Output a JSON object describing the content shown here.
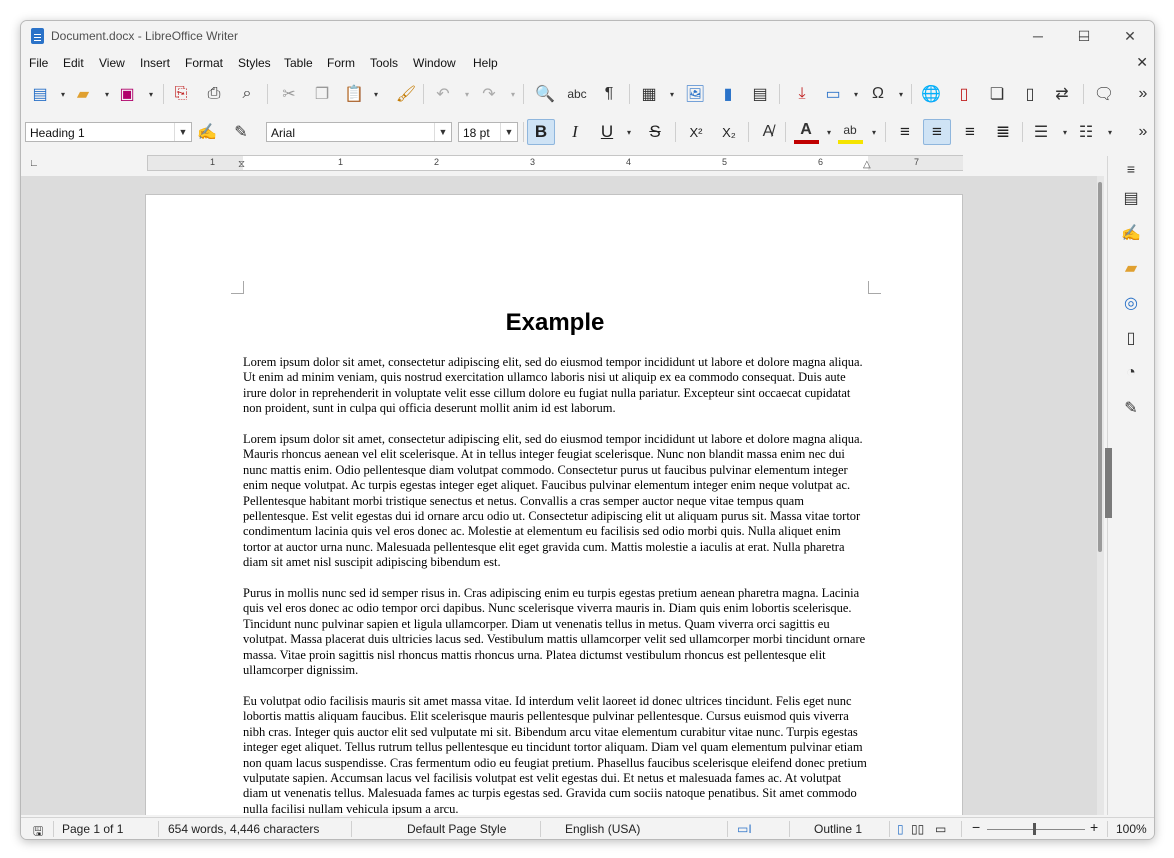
{
  "window": {
    "title": "Document.docx - LibreOffice Writer",
    "controls": {
      "minimize": "─",
      "maximize": "☐",
      "close": "✕"
    }
  },
  "menu": [
    {
      "label": "File"
    },
    {
      "label": "Edit"
    },
    {
      "label": "View"
    },
    {
      "label": "Insert"
    },
    {
      "label": "Format"
    },
    {
      "label": "Styles"
    },
    {
      "label": "Table"
    },
    {
      "label": "Form"
    },
    {
      "label": "Tools"
    },
    {
      "label": "Window"
    },
    {
      "label": "Help"
    }
  ],
  "toolbar": {
    "paragraph_style": "Heading 1",
    "font_name": "Arial",
    "font_size": "18 pt",
    "bold_label": "B",
    "italic_label": "I",
    "underline_label": "U",
    "strike_label": "S",
    "superscript_label": "X²",
    "subscript_label": "X₂",
    "more_label": "»",
    "font_color": "#c00000",
    "highlight_color": "#f5e400",
    "bold_active": true,
    "align_center_active": true
  },
  "ruler": {
    "numbers": [
      "1",
      "1",
      "2",
      "3",
      "4",
      "5",
      "6",
      "7"
    ]
  },
  "document": {
    "heading": "Example",
    "paragraphs": [
      "Lorem ipsum dolor sit amet, consectetur adipiscing elit, sed do eiusmod tempor incididunt ut labore et dolore magna aliqua. Ut enim ad minim veniam, quis nostrud exercitation ullamco laboris nisi ut aliquip ex ea commodo consequat. Duis aute irure dolor in reprehenderit in voluptate velit esse cillum dolore eu fugiat nulla pariatur. Excepteur sint occaecat cupidatat non proident, sunt in culpa qui officia deserunt mollit anim id est laborum.",
      "Lorem ipsum dolor sit amet, consectetur adipiscing elit, sed do eiusmod tempor incididunt ut labore et dolore magna aliqua. Mauris rhoncus aenean vel elit scelerisque. At in tellus integer feugiat scelerisque. Nunc non blandit massa enim nec dui nunc mattis enim. Odio pellentesque diam volutpat commodo. Consectetur purus ut faucibus pulvinar elementum integer enim neque volutpat. Ac turpis egestas integer eget aliquet. Faucibus pulvinar elementum integer enim neque volutpat ac. Pellentesque habitant morbi tristique senectus et netus. Convallis a cras semper auctor neque vitae tempus quam pellentesque. Est velit egestas dui id ornare arcu odio ut. Consectetur adipiscing elit ut aliquam purus sit. Massa vitae tortor condimentum lacinia quis vel eros donec ac. Molestie at elementum eu facilisis sed odio morbi quis. Nulla aliquet enim tortor at auctor urna nunc. Malesuada pellentesque elit eget gravida cum. Mattis molestie a iaculis at erat. Nulla pharetra diam sit amet nisl suscipit adipiscing bibendum est.",
      "Purus in mollis nunc sed id semper risus in. Cras adipiscing enim eu turpis egestas pretium aenean pharetra magna. Lacinia quis vel eros donec ac odio tempor orci dapibus. Nunc scelerisque viverra mauris in. Diam quis enim lobortis scelerisque. Tincidunt nunc pulvinar sapien et ligula ullamcorper. Diam ut venenatis tellus in metus. Quam viverra orci sagittis eu volutpat. Massa placerat duis ultricies lacus sed. Vestibulum mattis ullamcorper velit sed ullamcorper morbi tincidunt ornare massa. Vitae proin sagittis nisl rhoncus mattis rhoncus urna. Platea dictumst vestibulum rhoncus est pellentesque elit ullamcorper dignissim.",
      "Eu volutpat odio facilisis mauris sit amet massa vitae. Id interdum velit laoreet id donec ultrices tincidunt. Felis eget nunc lobortis mattis aliquam faucibus. Elit scelerisque mauris pellentesque pulvinar pellentesque. Cursus euismod quis viverra nibh cras. Integer quis auctor elit sed vulputate mi sit. Bibendum arcu vitae elementum curabitur vitae nunc. Turpis egestas integer eget aliquet. Tellus rutrum tellus pellentesque eu tincidunt tortor aliquam. Diam vel quam elementum pulvinar etiam non quam lacus suspendisse. Cras fermentum odio eu feugiat pretium. Phasellus faucibus scelerisque eleifend donec pretium vulputate sapien. Accumsan lacus vel facilisis volutpat est velit egestas dui. Et netus et malesuada fames ac. At volutpat diam ut venenatis tellus. Malesuada fames ac turpis egestas sed. Gravida cum sociis natoque penatibus. Sit amet commodo nulla facilisi nullam vehicula ipsum a arcu."
    ]
  },
  "statusbar": {
    "page": "Page 1 of 1",
    "words": "654 words, 4,446 characters",
    "page_style": "Default Page Style",
    "language": "English (USA)",
    "outline": "Outline 1",
    "zoom": "100%",
    "zoom_minus": "−",
    "zoom_plus": "+"
  }
}
